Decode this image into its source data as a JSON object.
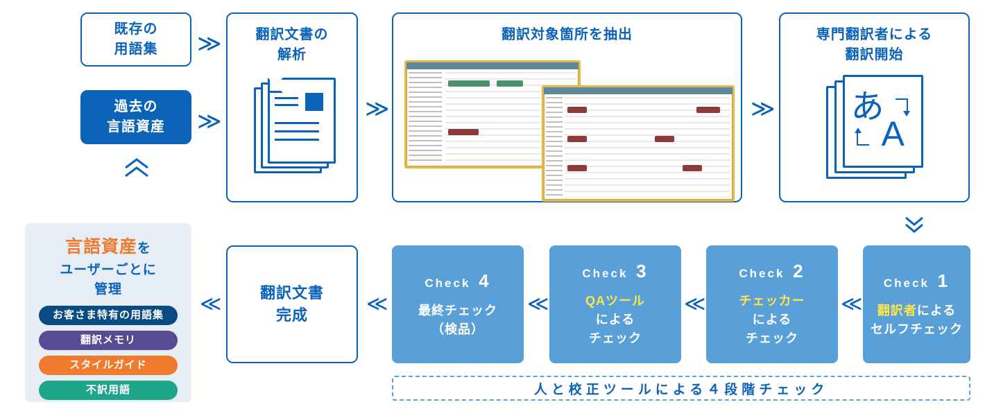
{
  "top": {
    "glossary": "既存の\n用語集",
    "past_assets": "過去の\n言語資産",
    "analyze": "翻訳文書の\n解析",
    "extract": "翻訳対象箇所を抽出",
    "translate": "専門翻訳者による\n翻訳開始"
  },
  "bottom": {
    "complete": "翻訳文書\n完成"
  },
  "checks": {
    "c1": {
      "label": "Check",
      "num": "1",
      "hl": "翻訳者",
      "rest": "による\nセルフチェック"
    },
    "c2": {
      "label": "Check",
      "num": "2",
      "hl": "チェッカー",
      "rest": "\nによる\nチェック"
    },
    "c3": {
      "label": "Check",
      "num": "3",
      "hl": "QAツール",
      "rest": "\nによる\nチェック"
    },
    "c4": {
      "label": "Check",
      "num": "4",
      "body": "最終チェック\n（検品）"
    }
  },
  "dashed_caption": "人と校正ツールによる４段階チェック",
  "mgmt": {
    "title_hl": "言語資産",
    "title_rest": "を\nユーザーごとに\n管理",
    "pill1": "お客さま特有の用語集",
    "pill2": "翻訳メモリ",
    "pill3": "スタイルガイド",
    "pill4": "不訳用語"
  },
  "arrows": {
    "right": "≫",
    "left": "≪"
  }
}
